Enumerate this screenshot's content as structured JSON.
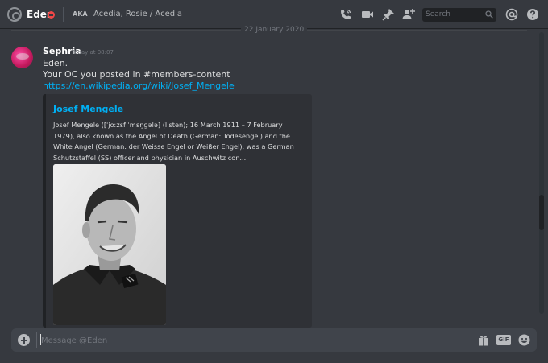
{
  "header": {
    "channel_name": "Eden",
    "aka_label": "AKA",
    "aka_names": "Acedia, Rosie / Acedia",
    "search_placeholder": "Search",
    "icons": [
      "call-icon",
      "video-icon",
      "pin-icon",
      "add-member-icon",
      "search-icon",
      "mention-icon",
      "help-icon"
    ]
  },
  "date_divider": "22 January 2020",
  "message": {
    "author": "Sephria",
    "timestamp": "Today at 08:07",
    "lines": [
      "Eden.",
      "Your OC you posted in #members-content"
    ],
    "link": "https://en.wikipedia.org/wiki/Josef_Mengele"
  },
  "embed": {
    "title": "Josef Mengele",
    "description": "Josef Mengele ([ˈjoːzɛf ˈmɛŋɡələ] (listen); 16 March 1911 – 7 February 1979), also known as the Angel of Death (German: Todesengel) and the White Angel (German: der Weisse Engel or Weißer Engel), was a German Schutzstaffel (SS) officer and physician in Auschwitz con..."
  },
  "composer": {
    "placeholder": "Message @Eden",
    "gif_label": "GIF"
  },
  "colors": {
    "background": "#36393f",
    "link": "#00b0f4",
    "dnd": "#f04747"
  }
}
